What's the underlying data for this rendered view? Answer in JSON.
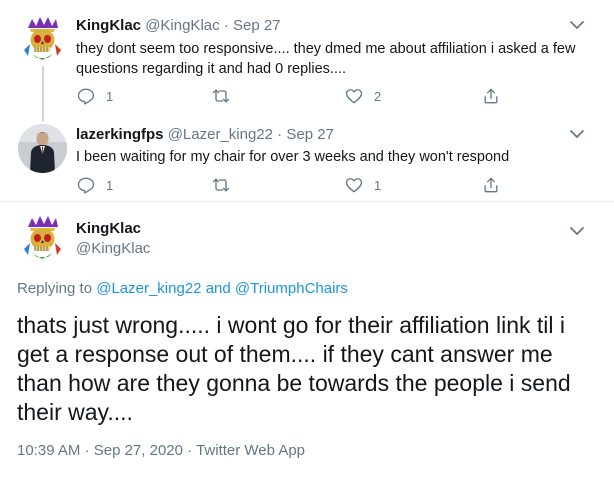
{
  "tweets": [
    {
      "name": "KingKlac",
      "handle": "@KingKlac",
      "sep": "·",
      "date": "Sep 27",
      "text": "they dont seem too responsive.... they dmed me about affiliation i asked a few questions regarding it and had 0 replies....",
      "reply_count": "1",
      "retweet_count": "",
      "like_count": "2"
    },
    {
      "name": "lazerkingfps",
      "handle": "@Lazer_king22",
      "sep": "·",
      "date": "Sep 27",
      "text": "I been waiting for my chair for over 3 weeks and they won't respond",
      "reply_count": "1",
      "retweet_count": "",
      "like_count": "1"
    }
  ],
  "main_tweet": {
    "name": "KingKlac",
    "handle": "@KingKlac",
    "replying_prefix": "Replying to",
    "replying_user1": "@Lazer_king22",
    "replying_and": "and",
    "replying_user2": "@TriumphChairs",
    "text": "thats just wrong..... i wont go for their affiliation link til i get a response out of them.... if they cant answer me than how are they gonna be towards the people i send their way....",
    "time": "10:39 AM",
    "sep1": "·",
    "date": "Sep 27, 2020",
    "sep2": "·",
    "source": "Twitter Web App"
  },
  "colors": {
    "link": "#1b95e0",
    "muted": "#657786",
    "thread_line": "#ccd6dd"
  },
  "icons": [
    "reply-icon",
    "retweet-icon",
    "like-icon",
    "share-icon",
    "chevron-down-icon",
    "skull-avatar",
    "person-avatar"
  ]
}
